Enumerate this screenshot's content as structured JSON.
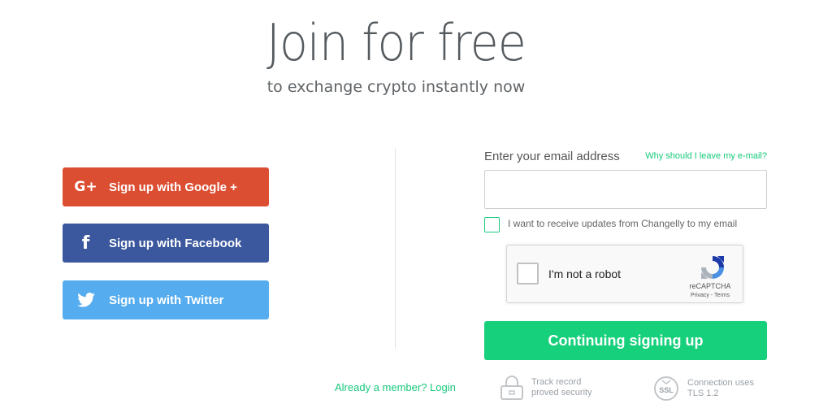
{
  "header": {
    "title": "Join for free",
    "subtitle": "to exchange crypto instantly now"
  },
  "social": {
    "google_label": "Sign up with Google +",
    "facebook_label": "Sign up with Facebook",
    "twitter_label": "Sign up with Twitter",
    "google_icon_text": "G+",
    "facebook_icon_text": "f"
  },
  "form": {
    "email_label": "Enter your email address",
    "why_link": "Why should I leave my e-mail?",
    "email_value": "",
    "updates_label": "I want to receive updates from Changelly to my email",
    "continue_label": "Continuing signing up"
  },
  "recaptcha": {
    "label": "I'm not a robot",
    "brand": "reCAPTCHA",
    "links": "Privacy - Terms"
  },
  "footer": {
    "login_link": "Already a member? Login",
    "track_line1": "Track record",
    "track_line2": "proved security",
    "ssl_badge": "SSL",
    "ssl_line1": "Connection uses",
    "ssl_line2": "TLS 1.2"
  },
  "colors": {
    "google": "#dc4e32",
    "facebook": "#3b579d",
    "twitter": "#55acee",
    "accent_green": "#16d07c"
  },
  "icons": {
    "google": "google-plus-icon",
    "facebook": "facebook-icon",
    "twitter": "twitter-bird-icon",
    "lock": "lock-icon",
    "ssl": "ssl-badge-icon",
    "recaptcha": "recaptcha-logo-icon"
  }
}
